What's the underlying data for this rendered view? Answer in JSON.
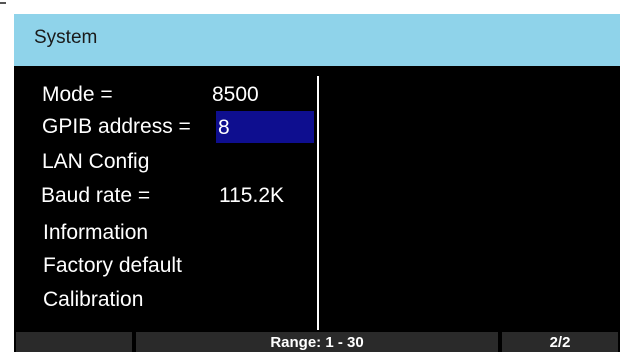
{
  "title_bar": {
    "title": "System"
  },
  "menu": {
    "mode": {
      "label": "Mode =",
      "value": "8500"
    },
    "gpib_address": {
      "label": "GPIB address =",
      "value": "8"
    },
    "lan_config": {
      "label": "LAN Config"
    },
    "baud_rate": {
      "label": "Baud rate =",
      "value": "115.2K"
    },
    "information": {
      "label": "Information"
    },
    "factory_default": {
      "label": "Factory default"
    },
    "calibration": {
      "label": "Calibration"
    }
  },
  "soft_keys": {
    "key1": "",
    "range": "Range: 1 - 30",
    "page": "2/2"
  },
  "colors": {
    "title_bar": "#8fd3ea",
    "display_background": "#000000",
    "selection": "#0e0e8f",
    "text": "#ffffff"
  }
}
